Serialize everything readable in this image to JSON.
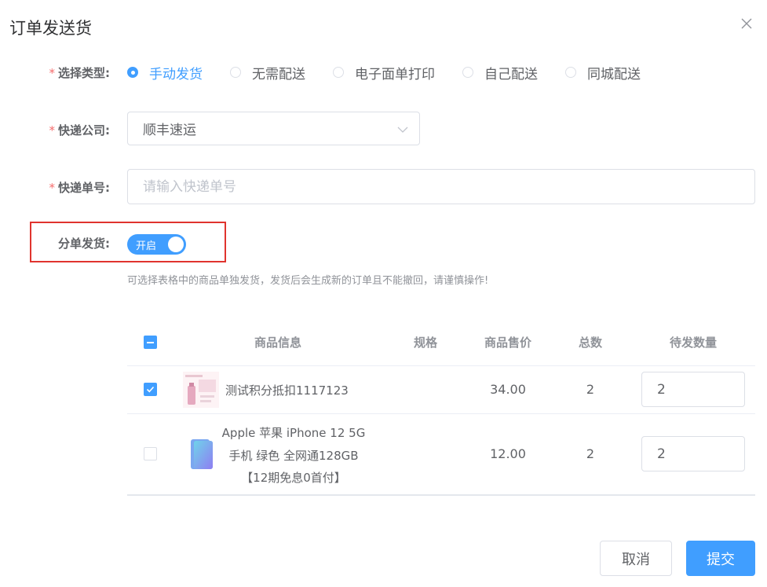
{
  "dialog": {
    "title": "订单发送货"
  },
  "form": {
    "type": {
      "label": "选择类型:",
      "options": [
        "手动发货",
        "无需配送",
        "电子面单打印",
        "自己配送",
        "同城配送"
      ],
      "selected": "手动发货"
    },
    "company": {
      "label": "快递公司:",
      "value": "顺丰速运"
    },
    "tracking": {
      "label": "快递单号:",
      "placeholder": "请输入快递单号"
    },
    "split": {
      "label": "分单发货:",
      "switch_text": "开启",
      "enabled": true
    },
    "hint": "可选择表格中的商品单独发货，发货后会生成新的订单且不能撤回，请谨慎操作!"
  },
  "table": {
    "columns": [
      "商品信息",
      "规格",
      "商品售价",
      "总数",
      "待发数量"
    ],
    "rows": [
      {
        "checked": true,
        "name": "测试积分抵扣1117123",
        "spec": "",
        "price": "34.00",
        "total": "2",
        "qty": "2"
      },
      {
        "checked": false,
        "name_lines": [
          "Apple 苹果 iPhone 12 5G",
          "手机 绿色 全网通128GB",
          "【12期免息0首付】"
        ],
        "spec": "",
        "price": "12.00",
        "total": "2",
        "qty": "2"
      }
    ]
  },
  "buttons": {
    "cancel": "取消",
    "submit": "提交"
  },
  "colors": {
    "primary": "#409eff",
    "required": "#f56c6c",
    "highlight_box": "#e0342e"
  }
}
